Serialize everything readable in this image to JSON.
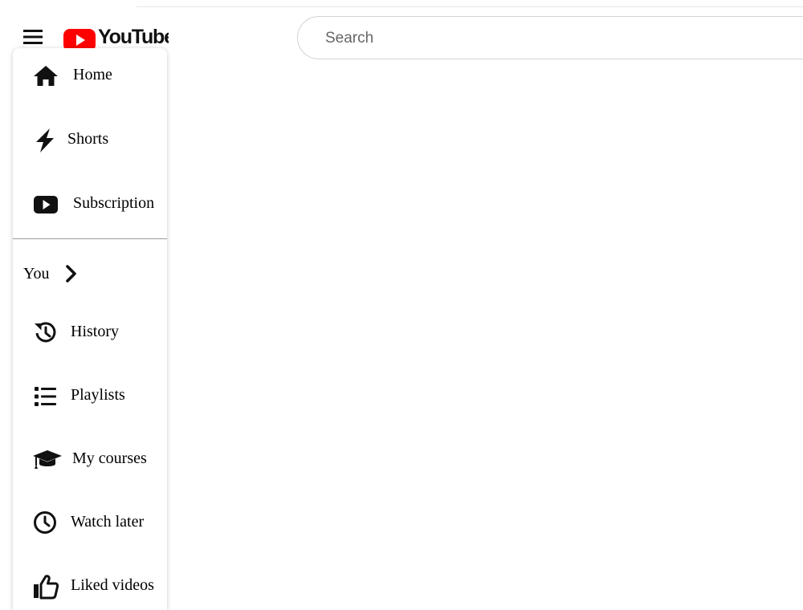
{
  "header": {
    "menu_icon": "hamburger-menu-icon",
    "logo_text": "YouTube",
    "logo_icon": "youtube-play-icon",
    "brand_color": "#ff0000",
    "search": {
      "placeholder": "Search",
      "value": ""
    }
  },
  "sidebar": {
    "main": [
      {
        "label": "Home",
        "icon": "home-icon"
      },
      {
        "label": "Shorts",
        "icon": "lightning-bolt-icon"
      },
      {
        "label": "Subscription",
        "icon": "play-box-icon"
      }
    ],
    "you": {
      "label": "You",
      "icon": "chevron-right-icon"
    },
    "personal": [
      {
        "label": "History",
        "icon": "history-icon"
      },
      {
        "label": "Playlists",
        "icon": "list-icon"
      },
      {
        "label": "My courses",
        "icon": "graduation-cap-icon"
      },
      {
        "label": "Watch later",
        "icon": "clock-icon"
      },
      {
        "label": "Liked videos",
        "icon": "thumbs-up-icon"
      }
    ]
  }
}
